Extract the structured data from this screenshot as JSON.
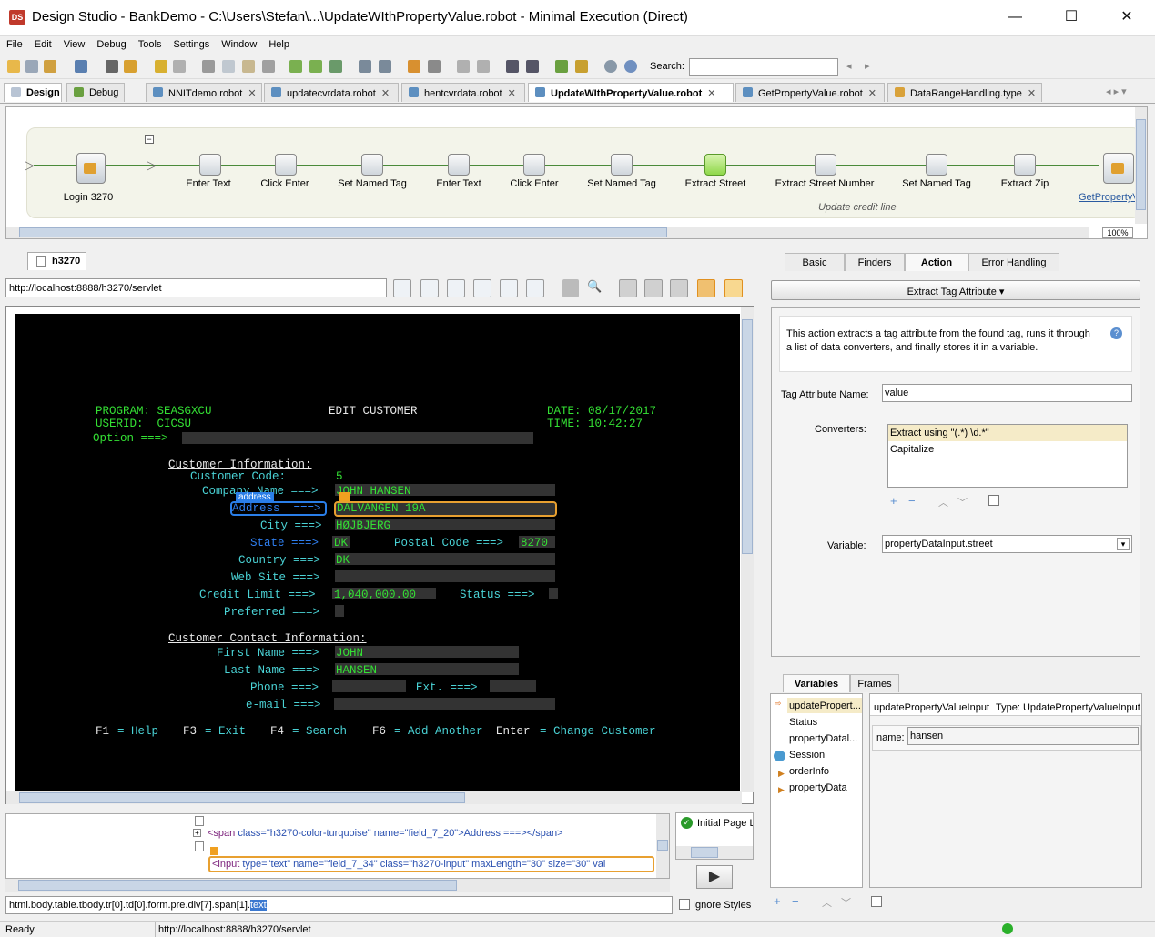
{
  "window": {
    "title": "Design Studio - BankDemo - C:\\Users\\Stefan\\...\\UpdateWIthPropertyValue.robot - Minimal Execution (Direct)",
    "app_icon": "DS",
    "minimize": "—",
    "maximize": "☐",
    "close": "✕"
  },
  "menu": [
    "File",
    "Edit",
    "View",
    "Debug",
    "Tools",
    "Settings",
    "Window",
    "Help"
  ],
  "toolbar": {
    "search_label": "Search:",
    "search_value": ""
  },
  "perspectives": {
    "design": "Design",
    "debug": "Debug"
  },
  "editor_tabs": [
    "NNITdemo.robot",
    "updatecvrdata.robot",
    "hentcvrdata.robot",
    "UpdateWIthPropertyValue.robot",
    "GetPropertyValue.robot",
    "DataRangeHandling.type"
  ],
  "flow": {
    "steps": [
      "Login 3270",
      "Enter Text",
      "Click Enter",
      "Set Named Tag",
      "Enter Text",
      "Click Enter",
      "Set Named Tag",
      "Extract Street",
      "Extract Street Number",
      "Set Named Tag",
      "Extract Zip",
      "GetPropertyV..."
    ],
    "group_label": "Update credit line",
    "zoom": "100%"
  },
  "browser": {
    "tab": "h3270",
    "url": "http://localhost:8888/h3270/servlet"
  },
  "terminal": {
    "program": "PROGRAM: SEASGXCU",
    "userid": "USERID:  CICSU",
    "screen_title": "EDIT CUSTOMER",
    "date": "DATE: 08/17/2017",
    "time": "TIME: 10:42:27",
    "option": "Option ===>",
    "section1": "Customer Information:",
    "cust_code_label": "Customer Code:",
    "cust_code": "5",
    "company_label": "Company Name ===>",
    "company": "JOHN HANSEN",
    "address_tag": "address",
    "address_label": "Address  ===>",
    "address": "DALVANGEN 19A",
    "city_label": "City ===>",
    "city": "HØJBJERG",
    "state_label": "State ===>",
    "state": "DK",
    "postal_label": "Postal Code ===>",
    "postal": "8270",
    "country_label": "Country ===>",
    "country": "DK",
    "website_label": "Web Site ===>",
    "credit_label": "Credit Limit ===>",
    "credit": "1,040,000.00",
    "status_label": "Status ===>",
    "preferred_label": "Preferred ===>",
    "section2": "Customer Contact Information:",
    "first_label": "First Name ===>",
    "first": "JOHN",
    "last_label": "Last Name ===>",
    "last": "HANSEN",
    "phone_label": "Phone ===>",
    "ext_label": "Ext. ===>",
    "email_label": "e-mail ===>",
    "f1": "F1",
    "f1t": "= Help",
    "f3": "F3",
    "f3t": "= Exit",
    "f4": "F4",
    "f4t": "= Search",
    "f6": "F6",
    "f6t": "= Add Another",
    "enter": "Enter",
    "entert": "= Change Customer"
  },
  "dom": {
    "line1_tag": "<span",
    "line1_attrs": " class=\"h3270-color-turquoise\" name=\"field_7_20\">Address ===></span>",
    "line2_tag": "<input",
    "line2_attrs": " type=\"text\" name=\"field_7_34\" class=\"h3270-input\" maxLength=\"30\" size=\"30\" val",
    "initial_page": "Initial Page Lo"
  },
  "path": {
    "value": "html.body.table.tbody.tr[0].td[0].form.pre.div[7].span[1].",
    "selected": "text",
    "ignore_styles": "Ignore Styles"
  },
  "status": {
    "left": "Ready.",
    "url": "http://localhost:8888/h3270/servlet"
  },
  "step_tabs": [
    "Basic",
    "Finders",
    "Action",
    "Error Handling"
  ],
  "action": {
    "selected": "Extract Tag Attribute",
    "description": "This action extracts a tag attribute from the found tag, runs it through a list of data converters, and finally stores it in a variable.",
    "tag_attr_label": "Tag Attribute Name:",
    "tag_attr_value": "value",
    "converters_label": "Converters:",
    "converters": [
      "Extract using \"(.*) \\d.*\"",
      "Capitalize"
    ],
    "variable_label": "Variable:",
    "variable_value": "propertyDataInput.street"
  },
  "vars_tabs": [
    "Variables",
    "Frames"
  ],
  "variables": [
    "updatePropert...",
    "Status",
    "propertyDatal...",
    "Session",
    "orderInfo",
    "propertyData"
  ],
  "var_detail": {
    "name_header": "updatePropertyValueInput",
    "type_header": "Type: UpdatePropertyValueInput",
    "name_label": "name:",
    "name_value": "hansen"
  }
}
